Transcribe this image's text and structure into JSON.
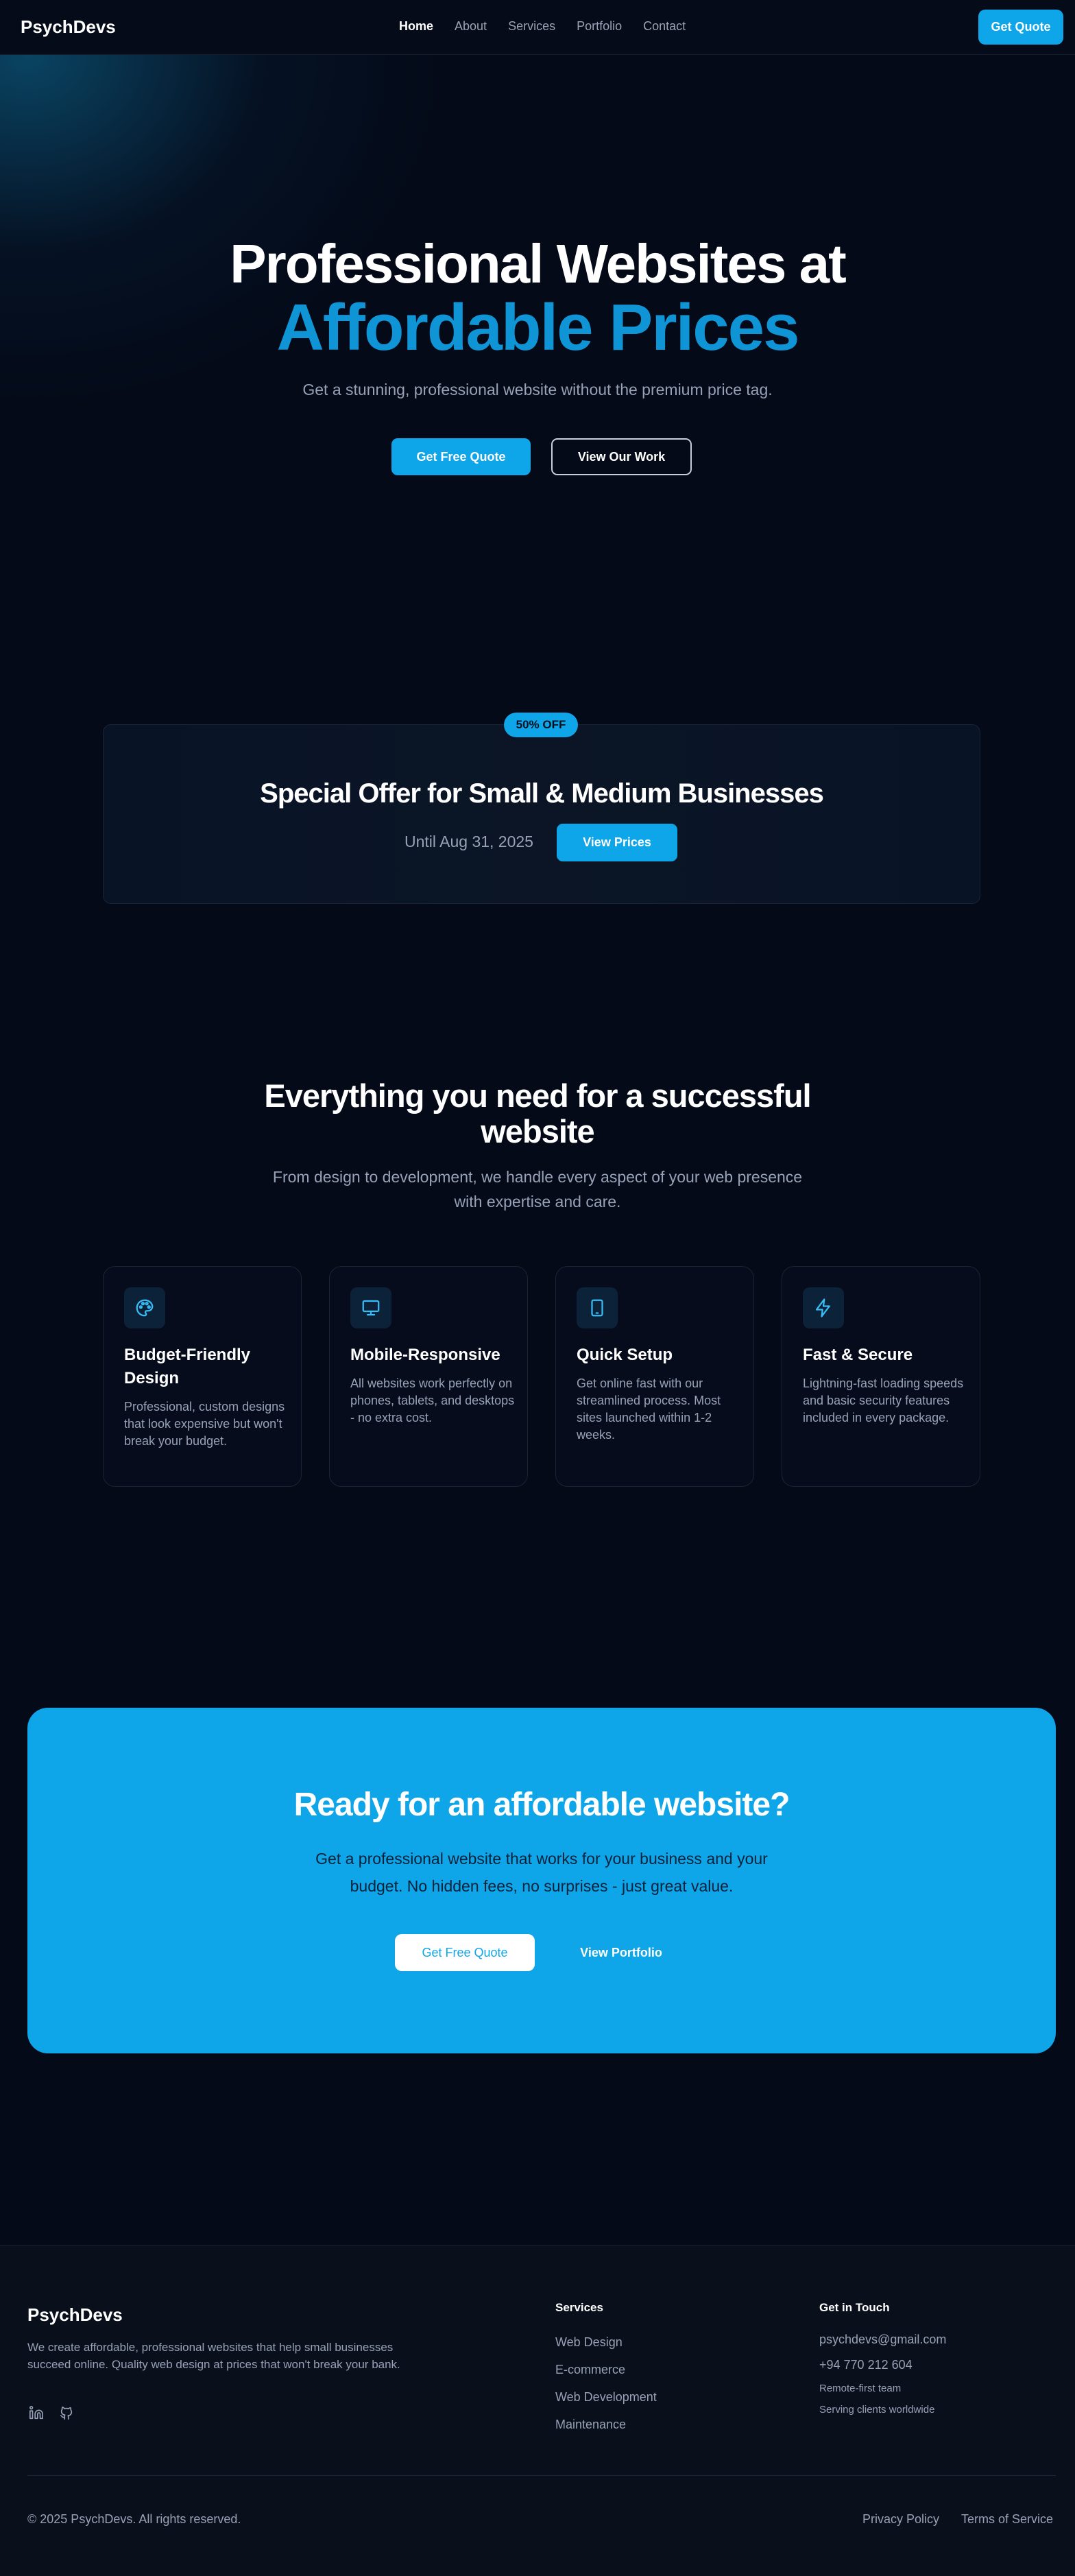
{
  "nav": {
    "brand": "PsychDevs",
    "links": [
      "Home",
      "About",
      "Services",
      "Portfolio",
      "Contact"
    ],
    "cta": "Get Quote"
  },
  "hero": {
    "title_line1": "Professional Websites at",
    "title_line2": "Affordable Prices",
    "subtitle": "Get a stunning, professional website without the premium price tag.",
    "primary_btn": "Get Free Quote",
    "secondary_btn": "View Our Work"
  },
  "offer": {
    "badge": "50% OFF",
    "title": "Special Offer for Small & Medium Businesses",
    "until": "Until Aug 31, 2025",
    "btn": "View Prices"
  },
  "features": {
    "title": "Everything you need for a successful website",
    "subtitle": "From design to development, we handle every aspect of your web presence with expertise and care.",
    "cards": [
      {
        "icon": "palette-icon",
        "title": "Budget-Friendly Design",
        "desc": "Professional, custom designs that look expensive but won't break your budget."
      },
      {
        "icon": "monitor-icon",
        "title": "Mobile-Responsive",
        "desc": "All websites work perfectly on phones, tablets, and desktops - no extra cost."
      },
      {
        "icon": "tablet-icon",
        "title": "Quick Setup",
        "desc": "Get online fast with our streamlined process. Most sites launched within 1-2 weeks."
      },
      {
        "icon": "bolt-icon",
        "title": "Fast & Secure",
        "desc": "Lightning-fast loading speeds and basic security features included in every package."
      }
    ]
  },
  "cta": {
    "title": "Ready for an affordable website?",
    "subtitle": "Get a professional website that works for your business and your budget. No hidden fees, no surprises - just great value.",
    "primary_btn": "Get Free Quote",
    "secondary_btn": "View Portfolio"
  },
  "footer": {
    "brand": "PsychDevs",
    "desc": "We create affordable, professional websites that help small businesses succeed online. Quality web design at prices that won't break your bank.",
    "social_icons": [
      "linkedin-icon",
      "github-icon"
    ],
    "services_heading": "Services",
    "services": [
      "Web Design",
      "E-commerce",
      "Web Development",
      "Maintenance"
    ],
    "contact_heading": "Get in Touch",
    "email": "psychdevs@gmail.com",
    "phone": "+94 770 212 604",
    "note1": "Remote-first team",
    "note2": "Serving clients worldwide",
    "copyright": "© 2025 PsychDevs. All rights reserved.",
    "privacy": "Privacy Policy",
    "terms": "Terms of Service"
  },
  "colors": {
    "accent": "#0ea5e9",
    "heading_accent": "#0f95d6",
    "background": "#040a18",
    "footer_bg": "#0a0f1c"
  }
}
